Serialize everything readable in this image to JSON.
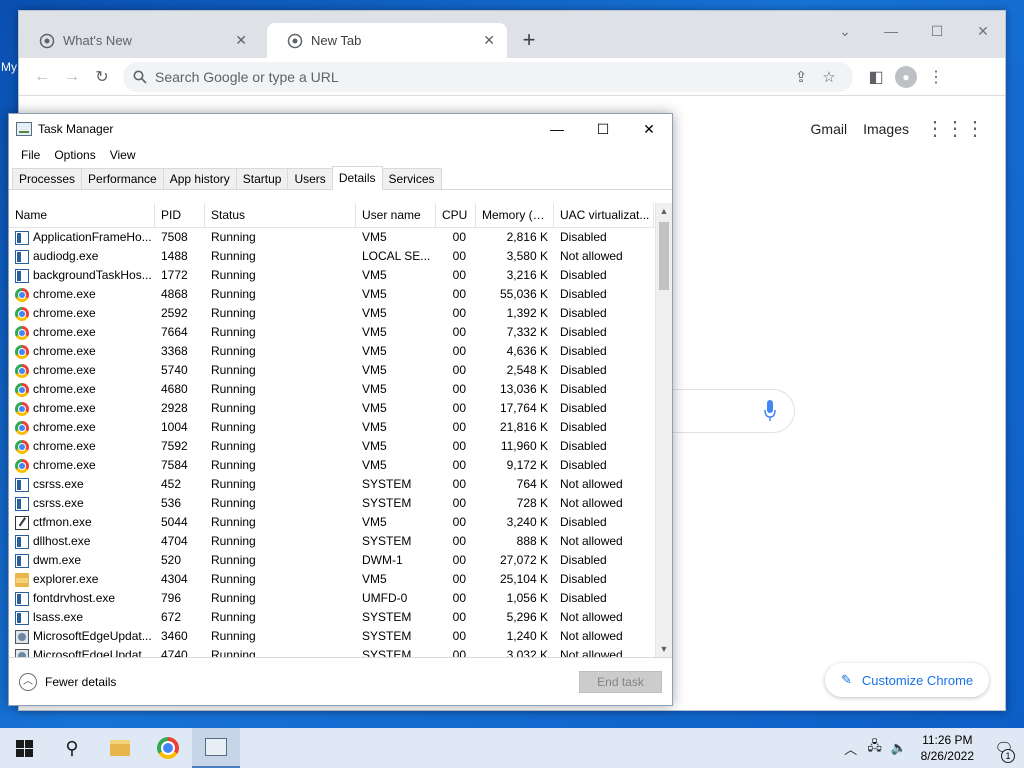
{
  "desktop": {
    "label": "My"
  },
  "chrome": {
    "tabs": [
      {
        "title": "What's New",
        "active": false
      },
      {
        "title": "New Tab",
        "active": true
      }
    ],
    "omnibox_placeholder": "Search Google or type a URL",
    "links": {
      "gmail": "Gmail",
      "images": "Images"
    },
    "customize": "Customize Chrome"
  },
  "taskmanager": {
    "title": "Task Manager",
    "menu": [
      "File",
      "Options",
      "View"
    ],
    "tabs": [
      "Processes",
      "Performance",
      "App history",
      "Startup",
      "Users",
      "Details",
      "Services"
    ],
    "active_tab": "Details",
    "columns": [
      "Name",
      "PID",
      "Status",
      "User name",
      "CPU",
      "Memory (a...",
      "UAC virtualizat..."
    ],
    "rows": [
      {
        "icon": "app-icon",
        "name": "ApplicationFrameHo...",
        "pid": "7508",
        "status": "Running",
        "user": "VM5",
        "cpu": "00",
        "mem": "2,816 K",
        "uac": "Disabled"
      },
      {
        "icon": "app-icon",
        "name": "audiodg.exe",
        "pid": "1488",
        "status": "Running",
        "user": "LOCAL SE...",
        "cpu": "00",
        "mem": "3,580 K",
        "uac": "Not allowed"
      },
      {
        "icon": "app-icon",
        "name": "backgroundTaskHos...",
        "pid": "1772",
        "status": "Running",
        "user": "VM5",
        "cpu": "00",
        "mem": "3,216 K",
        "uac": "Disabled"
      },
      {
        "icon": "chrome-icon",
        "name": "chrome.exe",
        "pid": "4868",
        "status": "Running",
        "user": "VM5",
        "cpu": "00",
        "mem": "55,036 K",
        "uac": "Disabled"
      },
      {
        "icon": "chrome-icon",
        "name": "chrome.exe",
        "pid": "2592",
        "status": "Running",
        "user": "VM5",
        "cpu": "00",
        "mem": "1,392 K",
        "uac": "Disabled"
      },
      {
        "icon": "chrome-icon",
        "name": "chrome.exe",
        "pid": "7664",
        "status": "Running",
        "user": "VM5",
        "cpu": "00",
        "mem": "7,332 K",
        "uac": "Disabled"
      },
      {
        "icon": "chrome-icon",
        "name": "chrome.exe",
        "pid": "3368",
        "status": "Running",
        "user": "VM5",
        "cpu": "00",
        "mem": "4,636 K",
        "uac": "Disabled"
      },
      {
        "icon": "chrome-icon",
        "name": "chrome.exe",
        "pid": "5740",
        "status": "Running",
        "user": "VM5",
        "cpu": "00",
        "mem": "2,548 K",
        "uac": "Disabled"
      },
      {
        "icon": "chrome-icon",
        "name": "chrome.exe",
        "pid": "4680",
        "status": "Running",
        "user": "VM5",
        "cpu": "00",
        "mem": "13,036 K",
        "uac": "Disabled"
      },
      {
        "icon": "chrome-icon",
        "name": "chrome.exe",
        "pid": "2928",
        "status": "Running",
        "user": "VM5",
        "cpu": "00",
        "mem": "17,764 K",
        "uac": "Disabled"
      },
      {
        "icon": "chrome-icon",
        "name": "chrome.exe",
        "pid": "1004",
        "status": "Running",
        "user": "VM5",
        "cpu": "00",
        "mem": "21,816 K",
        "uac": "Disabled"
      },
      {
        "icon": "chrome-icon",
        "name": "chrome.exe",
        "pid": "7592",
        "status": "Running",
        "user": "VM5",
        "cpu": "00",
        "mem": "11,960 K",
        "uac": "Disabled"
      },
      {
        "icon": "chrome-icon",
        "name": "chrome.exe",
        "pid": "7584",
        "status": "Running",
        "user": "VM5",
        "cpu": "00",
        "mem": "9,172 K",
        "uac": "Disabled"
      },
      {
        "icon": "app-icon",
        "name": "csrss.exe",
        "pid": "452",
        "status": "Running",
        "user": "SYSTEM",
        "cpu": "00",
        "mem": "764 K",
        "uac": "Not allowed"
      },
      {
        "icon": "app-icon",
        "name": "csrss.exe",
        "pid": "536",
        "status": "Running",
        "user": "SYSTEM",
        "cpu": "00",
        "mem": "728 K",
        "uac": "Not allowed"
      },
      {
        "icon": "pen-icon",
        "name": "ctfmon.exe",
        "pid": "5044",
        "status": "Running",
        "user": "VM5",
        "cpu": "00",
        "mem": "3,240 K",
        "uac": "Disabled"
      },
      {
        "icon": "app-icon",
        "name": "dllhost.exe",
        "pid": "4704",
        "status": "Running",
        "user": "SYSTEM",
        "cpu": "00",
        "mem": "888 K",
        "uac": "Not allowed"
      },
      {
        "icon": "app-icon",
        "name": "dwm.exe",
        "pid": "520",
        "status": "Running",
        "user": "DWM-1",
        "cpu": "00",
        "mem": "27,072 K",
        "uac": "Disabled"
      },
      {
        "icon": "folder-icon",
        "name": "explorer.exe",
        "pid": "4304",
        "status": "Running",
        "user": "VM5",
        "cpu": "00",
        "mem": "25,104 K",
        "uac": "Disabled"
      },
      {
        "icon": "app-icon",
        "name": "fontdrvhost.exe",
        "pid": "796",
        "status": "Running",
        "user": "UMFD-0",
        "cpu": "00",
        "mem": "1,056 K",
        "uac": "Disabled"
      },
      {
        "icon": "app-icon",
        "name": "lsass.exe",
        "pid": "672",
        "status": "Running",
        "user": "SYSTEM",
        "cpu": "00",
        "mem": "5,296 K",
        "uac": "Not allowed"
      },
      {
        "icon": "edge-update-icon",
        "name": "MicrosoftEdgeUpdat...",
        "pid": "3460",
        "status": "Running",
        "user": "SYSTEM",
        "cpu": "00",
        "mem": "1,240 K",
        "uac": "Not allowed"
      },
      {
        "icon": "edge-update-icon",
        "name": "MicrosoftEdgeUpdat...",
        "pid": "4740",
        "status": "Running",
        "user": "SYSTEM",
        "cpu": "00",
        "mem": "3,032 K",
        "uac": "Not allowed"
      }
    ],
    "fewer_details": "Fewer details",
    "end_task": "End task"
  },
  "taskbar": {
    "time": "11:26 PM",
    "date": "8/26/2022",
    "notification_count": "1"
  },
  "colors": {
    "accent": "#1a73e8",
    "taskbar": "#dfe9f5"
  }
}
